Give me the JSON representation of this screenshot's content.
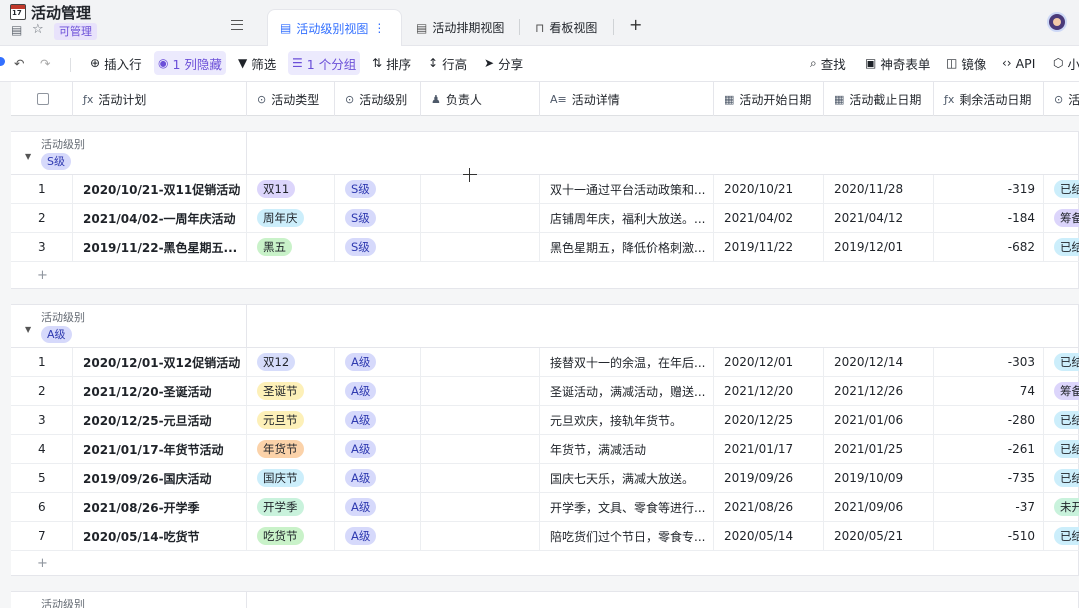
{
  "app": {
    "title": "活动管理",
    "permission": "可管理"
  },
  "tabs": [
    {
      "label": "活动级别视图",
      "active": true,
      "icon": "grid-icon"
    },
    {
      "label": "活动排期视图",
      "active": false,
      "icon": "grid-icon"
    },
    {
      "label": "看板视图",
      "active": false,
      "icon": "kanban-icon"
    }
  ],
  "toolbar": {
    "insert_row": "插入行",
    "hidden_cols": "1 列隐藏",
    "filter": "筛选",
    "group": "1 个分组",
    "sort": "排序",
    "row_height": "行高",
    "share": "分享",
    "find": "查找",
    "magic_form": "神奇表单",
    "mirror": "镜像",
    "api": "API",
    "more": "小"
  },
  "columns": [
    {
      "label": "活动计划",
      "icon": "formula-icon",
      "glyph": "ƒx"
    },
    {
      "label": "活动类型",
      "icon": "single-select-icon",
      "glyph": "⊙"
    },
    {
      "label": "活动级别",
      "icon": "single-select-icon",
      "glyph": "⊙"
    },
    {
      "label": "负责人",
      "icon": "person-icon",
      "glyph": "👤"
    },
    {
      "label": "活动详情",
      "icon": "text-icon",
      "glyph": "A≡"
    },
    {
      "label": "活动开始日期",
      "icon": "calendar-icon",
      "glyph": "▦"
    },
    {
      "label": "活动截止日期",
      "icon": "calendar-icon",
      "glyph": "▦"
    },
    {
      "label": "剩余活动日期",
      "icon": "formula-icon",
      "glyph": "ƒx"
    },
    {
      "label": "活",
      "icon": "single-select-icon",
      "glyph": "⊙"
    }
  ],
  "groups": [
    {
      "field_label": "活动级别",
      "value": "S级",
      "rows": [
        {
          "n": "1",
          "plan": "2020/10/21-双11促销活动",
          "type": "双11",
          "type_bg": "#dcd5fb",
          "level": "S级",
          "detail": "双十一通过平台活动政策和...",
          "start": "2020/10/21",
          "end": "2020/11/28",
          "remain": "-319",
          "status": "已结",
          "status_bg": "#cceefb"
        },
        {
          "n": "2",
          "plan": "2021/04/02-一周年庆活动",
          "type": "周年庆",
          "type_bg": "#cceefb",
          "level": "S级",
          "detail": "店铺周年庆，福利大放送。...",
          "start": "2021/04/02",
          "end": "2021/04/12",
          "remain": "-184",
          "status": "筹备",
          "status_bg": "#dcd5fb"
        },
        {
          "n": "3",
          "plan": "2019/11/22-黑色星期五...",
          "type": "黑五",
          "type_bg": "#c9f2c9",
          "level": "S级",
          "detail": "黑色星期五，降低价格刺激...",
          "start": "2019/11/22",
          "end": "2019/12/01",
          "remain": "-682",
          "status": "已结",
          "status_bg": "#cceefb"
        }
      ]
    },
    {
      "field_label": "活动级别",
      "value": "A级",
      "rows": [
        {
          "n": "1",
          "plan": "2020/12/01-双12促销活动",
          "type": "双12",
          "type_bg": "#d6dcfb",
          "level": "A级",
          "detail": "接替双十一的余温，在年后...",
          "start": "2020/12/01",
          "end": "2020/12/14",
          "remain": "-303",
          "status": "已结",
          "status_bg": "#cceefb"
        },
        {
          "n": "2",
          "plan": "2021/12/20-圣诞活动",
          "type": "圣诞节",
          "type_bg": "#fdf0b8",
          "level": "A级",
          "detail": "圣诞活动，满减活动，赠送...",
          "start": "2021/12/20",
          "end": "2021/12/26",
          "remain": "74",
          "status": "筹备",
          "status_bg": "#dcd5fb"
        },
        {
          "n": "3",
          "plan": "2020/12/25-元旦活动",
          "type": "元旦节",
          "type_bg": "#fdf0b8",
          "level": "A级",
          "detail": "元旦欢庆，接轨年货节。",
          "start": "2020/12/25",
          "end": "2021/01/06",
          "remain": "-280",
          "status": "已结",
          "status_bg": "#cceefb"
        },
        {
          "n": "4",
          "plan": "2021/01/17-年货节活动",
          "type": "年货节",
          "type_bg": "#fbd2a9",
          "level": "A级",
          "detail": "年货节，满减活动",
          "start": "2021/01/17",
          "end": "2021/01/25",
          "remain": "-261",
          "status": "已结",
          "status_bg": "#cceefb"
        },
        {
          "n": "5",
          "plan": "2019/09/26-国庆活动",
          "type": "国庆节",
          "type_bg": "#cceefb",
          "level": "A级",
          "detail": "国庆七天乐，满减大放送。",
          "start": "2019/09/26",
          "end": "2019/10/09",
          "remain": "-735",
          "status": "已结",
          "status_bg": "#cceefb"
        },
        {
          "n": "6",
          "plan": "2021/08/26-开学季",
          "type": "开学季",
          "type_bg": "#c9f2dc",
          "level": "A级",
          "detail": "开学季，文具、零食等进行...",
          "start": "2021/08/26",
          "end": "2021/09/06",
          "remain": "-37",
          "status": "未开",
          "status_bg": "#c9f2dc"
        },
        {
          "n": "7",
          "plan": "2020/05/14-吃货节",
          "type": "吃货节",
          "type_bg": "#c9f2c9",
          "level": "A级",
          "detail": "陪吃货们过个节日，零食专...",
          "start": "2020/05/14",
          "end": "2020/05/21",
          "remain": "-510",
          "status": "已结",
          "status_bg": "#cceefb"
        }
      ]
    },
    {
      "field_label": "活动级别",
      "value": "",
      "rows": []
    }
  ],
  "add_row_symbol": "+",
  "colors": {
    "accent": "#3370ff",
    "highlight": "#6b4fd8",
    "level_tag": "#d6d9fb"
  }
}
